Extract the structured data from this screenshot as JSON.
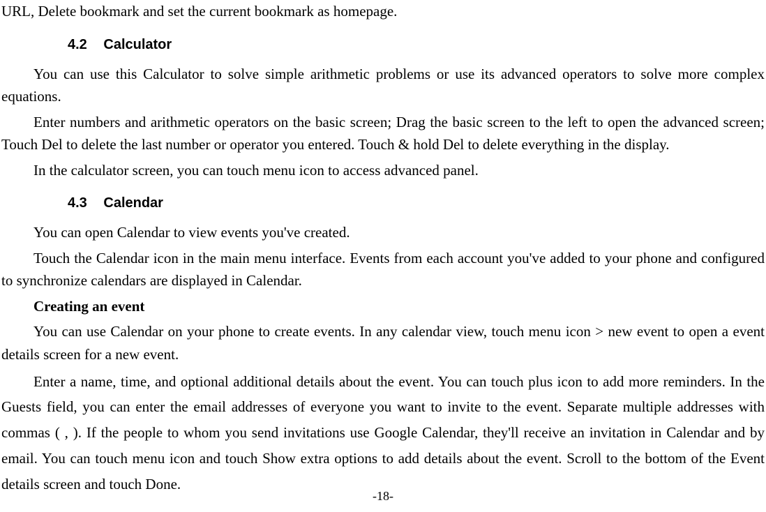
{
  "fragment_top": "URL, Delete bookmark and set the current bookmark as homepage.",
  "section_42": {
    "num": "4.2",
    "title": "Calculator",
    "p1": "You can use this Calculator to solve simple arithmetic problems or use its advanced operators to solve more complex equations.",
    "p2": "Enter numbers and arithmetic operators on the basic screen; Drag the basic screen to the left to open the advanced screen; Touch Del to delete the last number or operator you entered. Touch & hold Del to delete everything in the display.",
    "p3": "In the calculator screen, you can touch menu icon to access advanced panel."
  },
  "section_43": {
    "num": "4.3",
    "title": "Calendar",
    "p1": "You can open Calendar to view events you've created.",
    "p2": "Touch the Calendar icon in the main menu interface. Events from each account you've added to your phone and configured to synchronize calendars are displayed in Calendar.",
    "sub_heading": "Creating an event",
    "p3": "You can use Calendar on your phone to create events. In any calendar view, touch menu icon > new event to open a event details screen for a new event.",
    "p4": "Enter a name, time, and optional additional details about the event. You can touch plus icon to add more reminders. In the Guests field, you can enter the email addresses of everyone you want to invite to the event. Separate multiple addresses with commas ( , ). If the people to whom you send invitations use Google Calendar, they'll receive an invitation in Calendar and by email. You can touch menu icon and touch Show extra options to add details about the event. Scroll to the bottom of the Event details screen and touch Done."
  },
  "page_number": "-18-"
}
